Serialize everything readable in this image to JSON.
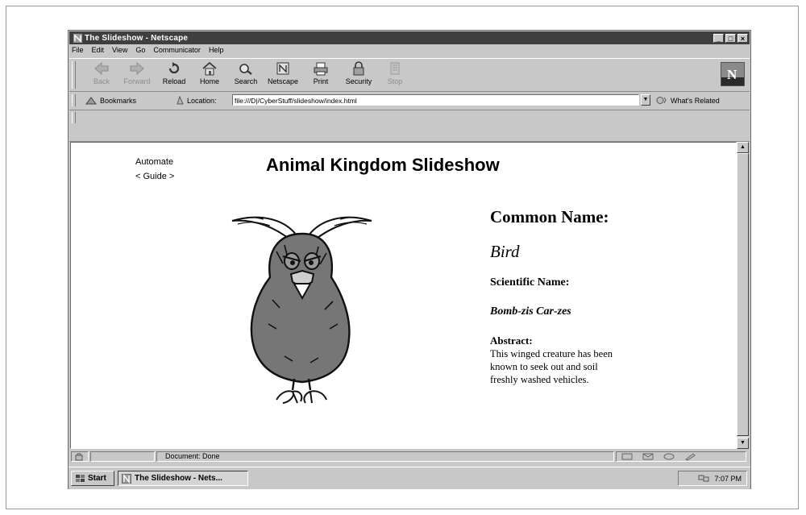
{
  "window": {
    "title": "The Slideshow - Netscape",
    "min": "_",
    "max": "□",
    "close": "×"
  },
  "menu": [
    "File",
    "Edit",
    "View",
    "Go",
    "Communicator",
    "Help"
  ],
  "toolbar": {
    "buttons": [
      {
        "label": "Back",
        "icon": "back-icon",
        "enabled": false
      },
      {
        "label": "Forward",
        "icon": "forward-icon",
        "enabled": false
      },
      {
        "label": "Reload",
        "icon": "reload-icon",
        "enabled": true
      },
      {
        "label": "Home",
        "icon": "home-icon",
        "enabled": true
      },
      {
        "label": "Search",
        "icon": "search-icon",
        "enabled": true
      },
      {
        "label": "Netscape",
        "icon": "netscape-icon",
        "enabled": true
      },
      {
        "label": "Print",
        "icon": "print-icon",
        "enabled": true
      },
      {
        "label": "Security",
        "icon": "security-icon",
        "enabled": true
      },
      {
        "label": "Stop",
        "icon": "stop-icon",
        "enabled": false
      }
    ]
  },
  "location": {
    "bookmarks_label": "Bookmarks",
    "location_label": "Location:",
    "url": "file:///D|/CyberStuff/slideshow/index.html",
    "related_label": "What's Related"
  },
  "page": {
    "nav_automate": "Automate",
    "nav_guide": "< Guide >",
    "title": "Animal Kingdom Slideshow",
    "common_name_heading": "Common Name:",
    "common_name": "Bird",
    "scientific_name_heading": "Scientific Name:",
    "scientific_name": "Bomb-zis Car-zes",
    "abstract_heading": "Abstract:",
    "abstract": "This winged creature has been known to seek out and soil freshly washed vehicles."
  },
  "status": {
    "text": "Document: Done"
  },
  "taskbar": {
    "start_label": "Start",
    "task_label": "The Slideshow - Nets...",
    "clock": "7:07 PM"
  }
}
